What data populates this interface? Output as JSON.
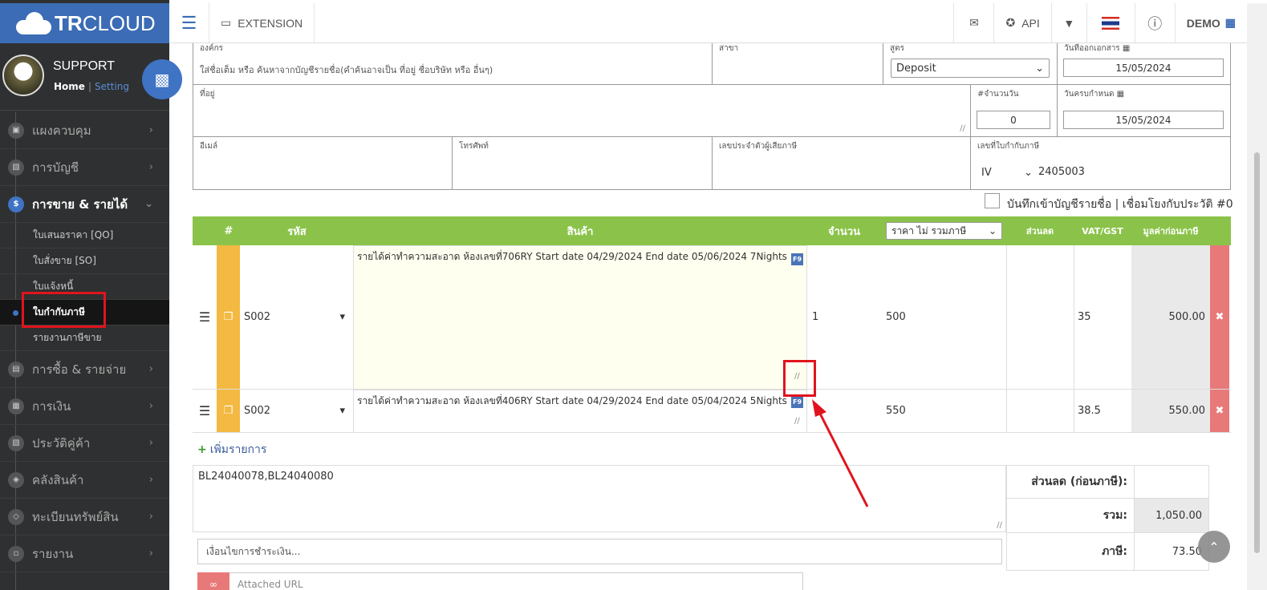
{
  "brand": {
    "name_bold": "TR",
    "name_rest": "CLOUD"
  },
  "profile": {
    "name": "SUPPORT",
    "home": "Home",
    "separator": "|",
    "setting": "Setting"
  },
  "topbar": {
    "extension": "EXTENSION",
    "api": "API",
    "user": "DEMO"
  },
  "sidebar": {
    "items": [
      {
        "label": "แผงควบคุม"
      },
      {
        "label": "การบัญชี"
      },
      {
        "label": "การขาย & รายได้"
      },
      {
        "label": "การซื้อ & รายจ่าย"
      },
      {
        "label": "การเงิน"
      },
      {
        "label": "ประวัติคู่ค้า"
      },
      {
        "label": "คลังสินค้า"
      },
      {
        "label": "ทะเบียนทรัพย์สิน"
      },
      {
        "label": "รายงาน"
      }
    ],
    "subitems": [
      {
        "label": "ใบเสนอราคา [QO]"
      },
      {
        "label": "ใบสั่งขาย [SO]"
      },
      {
        "label": "ใบแจ้งหนี้"
      },
      {
        "label": "ใบกำกับภาษี"
      },
      {
        "label": "รายงานภาษีขาย"
      }
    ]
  },
  "form": {
    "org_label": "องค์กร",
    "org_placeholder": "ใส่ชื่อเต็ม หรือ ค้นหาจากบัญชีรายชื่อ(คำค้นอาจเป็น ที่อยู่ ชื่อบริษัท หรือ อื่นๆ)",
    "branch_label": "สาขา",
    "formula_label": "สูตร",
    "formula_value": "Deposit",
    "doc_date_label": "วันที่ออกเอกสาร",
    "doc_date": "15/05/2024",
    "address_label": "ที่อยู่",
    "days_label": "#จำนวนวัน",
    "days_value": "0",
    "due_label": "วันครบกำหนด",
    "due_date": "15/05/2024",
    "email_label": "อีเมล์",
    "phone_label": "โทรศัพท์",
    "taxid_label": "เลขประจำตัวผู้เสียภาษี",
    "taxinv_label": "เลขที่ใบกำกับภาษี",
    "taxinv_prefix": "IV",
    "taxinv_number": "2405003",
    "save_contact": "บันทึกเข้าบัญชีรายชื่อ | เชื่อมโยงกับประวัติ #0"
  },
  "grid": {
    "headers": {
      "num": "#",
      "code": "รหัส",
      "product": "สินค้า",
      "qty": "จำนวน",
      "price_mode": "ราคา ไม่ รวมภาษี",
      "discount": "ส่วนลด",
      "vat": "VAT/GST",
      "pretax": "มูลค่าก่อนภาษี"
    },
    "rows": [
      {
        "code": "S002",
        "desc": "รายได้ค่าทำความสะอาด ห้องเลขที่706RY Start date 04/29/2024 End date 05/06/2024 7Nights",
        "qty": "1",
        "price": "500",
        "vat": "35",
        "amount": "500.00"
      },
      {
        "code": "S002",
        "desc": "รายได้ค่าทำความสะอาด ห้องเลขที่406RY Start date 04/29/2024 End date 05/04/2024 5Nights",
        "qty": "",
        "price": "550",
        "vat": "38.5",
        "amount": "550.00"
      }
    ],
    "f9": "F9",
    "add_item": "เพิ่มรายการ"
  },
  "notes": "BL24040078,BL24040080",
  "payment_placeholder": "เงื่อนไขการชำระเงิน...",
  "attach_placeholder": "Attached URL",
  "totals": {
    "discount_label": "ส่วนลด (ก่อนภาษี):",
    "discount_value": "",
    "sum_label": "รวม:",
    "sum_value": "1,050.00",
    "tax_label": "ภาษี:",
    "tax_value": "73.50"
  },
  "colors": {
    "brand": "#3b6cb5",
    "grid_header": "#8bc34a",
    "row_marker": "#f4b942",
    "delete": "#e87979",
    "highlight": "#e0141e"
  }
}
